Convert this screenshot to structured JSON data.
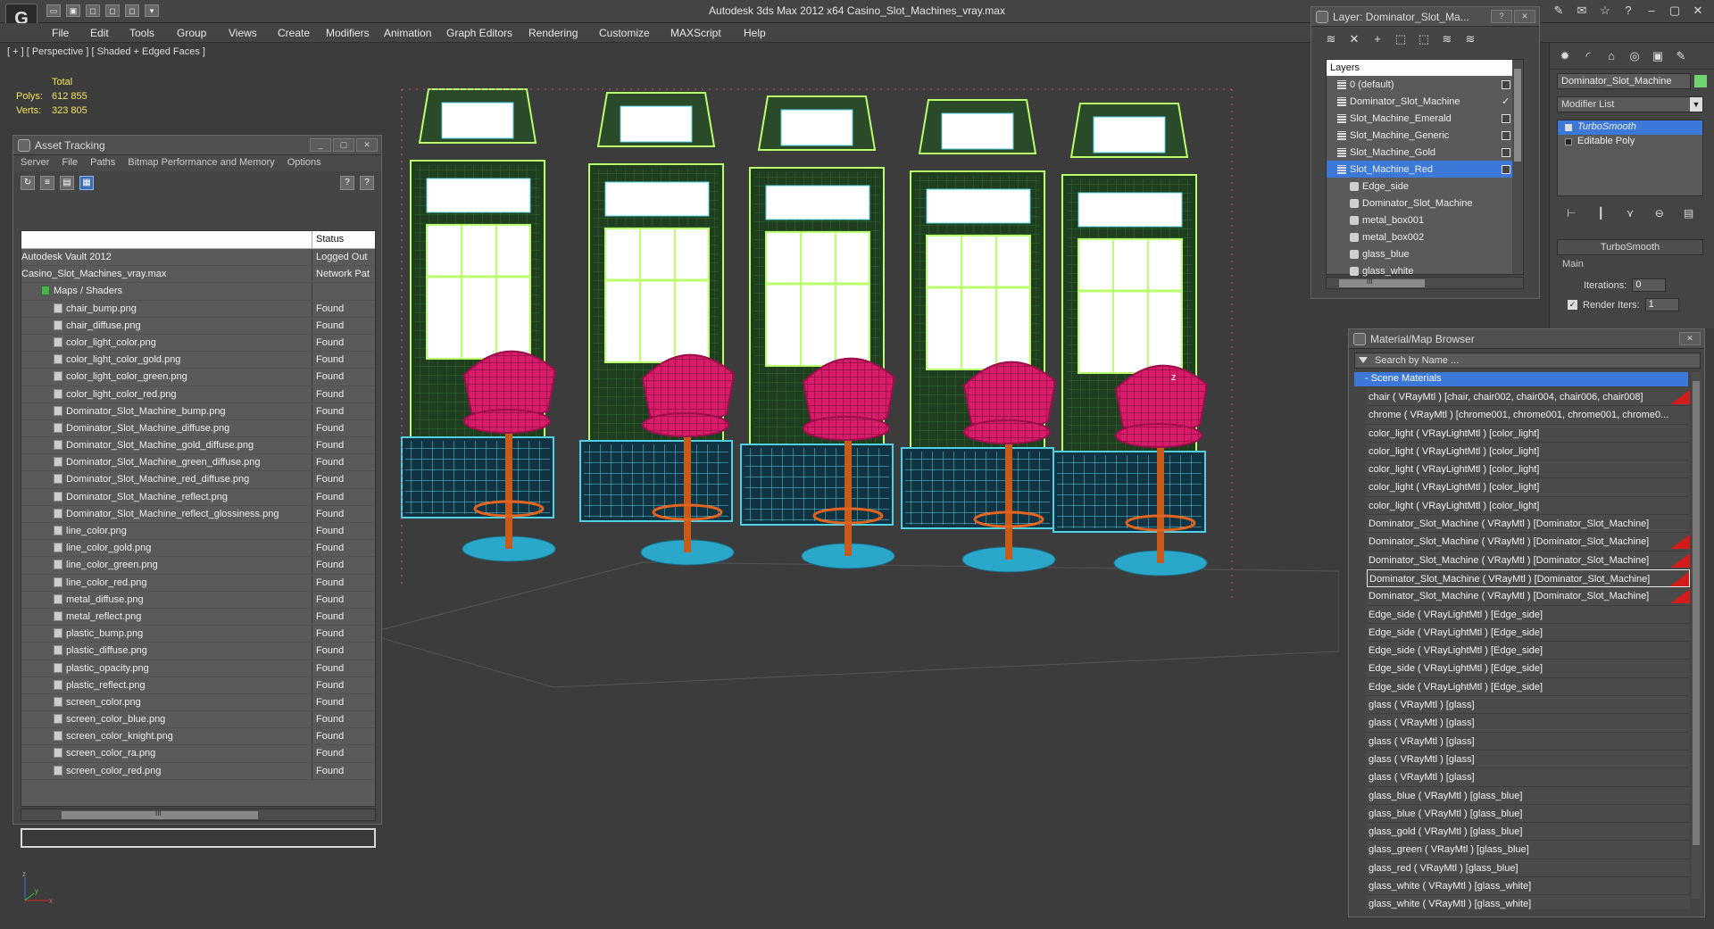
{
  "app": {
    "logo": "G",
    "title": "Autodesk 3ds Max  2012 x64     Casino_Slot_Machines_vray.max"
  },
  "quick_access": [
    "open",
    "save",
    "undo",
    "redo",
    "new",
    "hold"
  ],
  "menu": [
    "File",
    "Edit",
    "Tools",
    "Group",
    "Views",
    "Create",
    "Modifiers",
    "Animation",
    "Graph Editors",
    "Rendering",
    "Customize",
    "MAXScript",
    "Help"
  ],
  "viewport": {
    "label": "[ + ] [ Perspective ] [ Shaded + Edged Faces ]",
    "stats_header": "Total",
    "polys_label": "Polys:",
    "polys_value": "612 855",
    "verts_label": "Verts:",
    "verts_value": "323 805",
    "axis_x": "x",
    "axis_y": "y",
    "axis_z": "z",
    "model_label": "z"
  },
  "asset_tracking": {
    "title": "Asset Tracking",
    "menu": [
      "Server",
      "File",
      "Paths",
      "Bitmap Performance and Memory",
      "Options"
    ],
    "status_header": "Status",
    "rows": [
      {
        "name": "Autodesk Vault 2012",
        "status": "Logged Out",
        "level": 0
      },
      {
        "name": "Casino_Slot_Machines_vray.max",
        "status": "Network Pat",
        "level": 0
      },
      {
        "name": "Maps / Shaders",
        "status": "",
        "level": 1
      },
      {
        "name": "chair_bump.png",
        "status": "Found",
        "level": 2
      },
      {
        "name": "chair_diffuse.png",
        "status": "Found",
        "level": 2
      },
      {
        "name": "color_light_color.png",
        "status": "Found",
        "level": 2
      },
      {
        "name": "color_light_color_gold.png",
        "status": "Found",
        "level": 2
      },
      {
        "name": "color_light_color_green.png",
        "status": "Found",
        "level": 2
      },
      {
        "name": "color_light_color_red.png",
        "status": "Found",
        "level": 2
      },
      {
        "name": "Dominator_Slot_Machine_bump.png",
        "status": "Found",
        "level": 2
      },
      {
        "name": "Dominator_Slot_Machine_diffuse.png",
        "status": "Found",
        "level": 2
      },
      {
        "name": "Dominator_Slot_Machine_gold_diffuse.png",
        "status": "Found",
        "level": 2
      },
      {
        "name": "Dominator_Slot_Machine_green_diffuse.png",
        "status": "Found",
        "level": 2
      },
      {
        "name": "Dominator_Slot_Machine_red_diffuse.png",
        "status": "Found",
        "level": 2
      },
      {
        "name": "Dominator_Slot_Machine_reflect.png",
        "status": "Found",
        "level": 2
      },
      {
        "name": "Dominator_Slot_Machine_reflect_glossiness.png",
        "status": "Found",
        "level": 2
      },
      {
        "name": "line_color.png",
        "status": "Found",
        "level": 2
      },
      {
        "name": "line_color_gold.png",
        "status": "Found",
        "level": 2
      },
      {
        "name": "line_color_green.png",
        "status": "Found",
        "level": 2
      },
      {
        "name": "line_color_red.png",
        "status": "Found",
        "level": 2
      },
      {
        "name": "metal_diffuse.png",
        "status": "Found",
        "level": 2
      },
      {
        "name": "metal_reflect.png",
        "status": "Found",
        "level": 2
      },
      {
        "name": "plastic_bump.png",
        "status": "Found",
        "level": 2
      },
      {
        "name": "plastic_diffuse.png",
        "status": "Found",
        "level": 2
      },
      {
        "name": "plastic_opacity.png",
        "status": "Found",
        "level": 2
      },
      {
        "name": "plastic_reflect.png",
        "status": "Found",
        "level": 2
      },
      {
        "name": "screen_color.png",
        "status": "Found",
        "level": 2
      },
      {
        "name": "screen_color_blue.png",
        "status": "Found",
        "level": 2
      },
      {
        "name": "screen_color_knight.png",
        "status": "Found",
        "level": 2
      },
      {
        "name": "screen_color_ra.png",
        "status": "Found",
        "level": 2
      },
      {
        "name": "screen_color_red.png",
        "status": "Found",
        "level": 2
      }
    ],
    "scroll_grip": "III"
  },
  "layers": {
    "title": "Layer: Dominator_Slot_Ma...",
    "header": "Layers",
    "rows": [
      {
        "name": "0 (default)",
        "type": "layer",
        "indent": 0,
        "state": "box"
      },
      {
        "name": "Dominator_Slot_Machine",
        "type": "layer",
        "indent": 0,
        "state": "check"
      },
      {
        "name": "Slot_Machine_Emerald",
        "type": "layer",
        "indent": 0,
        "state": "box"
      },
      {
        "name": "Slot_Machine_Generic",
        "type": "layer",
        "indent": 0,
        "state": "box"
      },
      {
        "name": "Slot_Machine_Gold",
        "type": "layer",
        "indent": 0,
        "state": "box"
      },
      {
        "name": "Slot_Machine_Red",
        "type": "layer",
        "indent": 0,
        "state": "box",
        "selected": true
      },
      {
        "name": "Edge_side",
        "type": "object",
        "indent": 1,
        "state": ""
      },
      {
        "name": "Dominator_Slot_Machine",
        "type": "object",
        "indent": 1,
        "state": ""
      },
      {
        "name": "metal_box001",
        "type": "object",
        "indent": 1,
        "state": ""
      },
      {
        "name": "metal_box002",
        "type": "object",
        "indent": 1,
        "state": ""
      },
      {
        "name": "glass_blue",
        "type": "object",
        "indent": 1,
        "state": ""
      },
      {
        "name": "glass_white",
        "type": "object",
        "indent": 1,
        "state": ""
      }
    ],
    "scroll_grip": "III"
  },
  "command_panel": {
    "object_name": "Dominator_Slot_Machine",
    "object_color": "#6fd36f",
    "modifier_list_label": "Modifier List",
    "stack": [
      "TurboSmooth",
      "Editable Poly"
    ],
    "rollout_title": "TurboSmooth",
    "main_label": "Main",
    "iterations_label": "Iterations:",
    "iterations_value": "0",
    "render_iters_label": "Render Iters:",
    "render_iters_value": "1"
  },
  "material_browser": {
    "title": "Material/Map Browser",
    "search_placeholder": "Search by Name ...",
    "group": "- Scene Materials",
    "rows": [
      {
        "text": "chair  ( VRayMtl ) [chair, chair002, chair004, chair006, chair008]",
        "red": true
      },
      {
        "text": "chrome  ( VRayMtl ) [chrome001, chrome001, chrome001, chrome0...",
        "red": false
      },
      {
        "text": "color_light  ( VRayLightMtl ) [color_light]",
        "red": false
      },
      {
        "text": "color_light  ( VRayLightMtl ) [color_light]",
        "red": false
      },
      {
        "text": "color_light  ( VRayLightMtl ) [color_light]",
        "red": false
      },
      {
        "text": "color_light  ( VRayLightMtl ) [color_light]",
        "red": false
      },
      {
        "text": "color_light  ( VRayLightMtl ) [color_light]",
        "red": false
      },
      {
        "text": "Dominator_Slot_Machine  ( VRayMtl ) [Dominator_Slot_Machine]",
        "red": false
      },
      {
        "text": "Dominator_Slot_Machine  ( VRayMtl ) [Dominator_Slot_Machine]",
        "red": true
      },
      {
        "text": "Dominator_Slot_Machine  ( VRayMtl ) [Dominator_Slot_Machine]",
        "red": true
      },
      {
        "text": "Dominator_Slot_Machine  ( VRayMtl ) [Dominator_Slot_Machine]",
        "red": true,
        "highlight": true
      },
      {
        "text": "Dominator_Slot_Machine  ( VRayMtl ) [Dominator_Slot_Machine]",
        "red": true
      },
      {
        "text": "Edge_side  ( VRayLightMtl ) [Edge_side]",
        "red": false
      },
      {
        "text": "Edge_side  ( VRayLightMtl ) [Edge_side]",
        "red": false
      },
      {
        "text": "Edge_side  ( VRayLightMtl ) [Edge_side]",
        "red": false
      },
      {
        "text": "Edge_side  ( VRayLightMtl ) [Edge_side]",
        "red": false
      },
      {
        "text": "Edge_side  ( VRayLightMtl ) [Edge_side]",
        "red": false
      },
      {
        "text": "glass  ( VRayMtl ) [glass]",
        "red": false
      },
      {
        "text": "glass  ( VRayMtl ) [glass]",
        "red": false
      },
      {
        "text": "glass  ( VRayMtl ) [glass]",
        "red": false
      },
      {
        "text": "glass  ( VRayMtl ) [glass]",
        "red": false
      },
      {
        "text": "glass  ( VRayMtl ) [glass]",
        "red": false
      },
      {
        "text": "glass_blue  ( VRayMtl ) [glass_blue]",
        "red": false
      },
      {
        "text": "glass_blue  ( VRayMtl ) [glass_blue]",
        "red": false
      },
      {
        "text": "glass_gold  ( VRayMtl ) [glass_blue]",
        "red": false
      },
      {
        "text": "glass_green  ( VRayMtl ) [glass_blue]",
        "red": false
      },
      {
        "text": "glass_red  ( VRayMtl ) [glass_blue]",
        "red": false
      },
      {
        "text": "glass_white  ( VRayMtl ) [glass_white]",
        "red": false
      },
      {
        "text": "glass_white  ( VRayMtl ) [glass_white]",
        "red": false
      }
    ]
  },
  "colors": {
    "selection": "#3c78d8",
    "wire_green": "#b8ff6a",
    "wire_cyan": "#4fd0e6",
    "chair": "#d81b6a",
    "base": "#2aa7c9",
    "stats": "#f2e35b"
  }
}
